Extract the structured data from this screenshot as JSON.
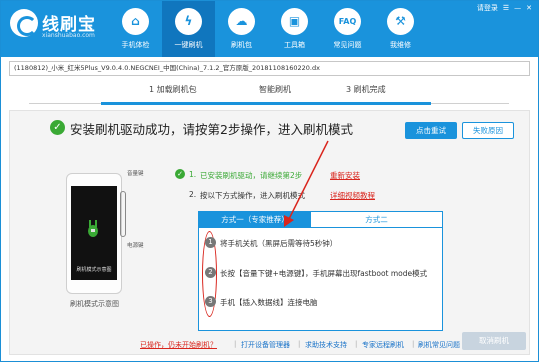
{
  "app": {
    "brand": "线刷宝",
    "brand_sub": "xianshuabao.com",
    "user_label": "请登录",
    "win_controls": [
      "☰",
      "—",
      "✕"
    ]
  },
  "nav": [
    {
      "label": "手机体检",
      "icon": "phone-check-icon",
      "glyph": "⌂",
      "active": false
    },
    {
      "label": "一键刷机",
      "icon": "flash-icon",
      "glyph": "ϟ",
      "active": true
    },
    {
      "label": "刷机包",
      "icon": "rom-package-icon",
      "glyph": "☁",
      "active": false
    },
    {
      "label": "工具箱",
      "icon": "toolbox-icon",
      "glyph": "▣",
      "active": false
    },
    {
      "label": "常见问题",
      "icon": "faq-icon",
      "glyph": "FAQ",
      "active": false
    },
    {
      "label": "我维修",
      "icon": "repair-icon",
      "glyph": "⚒",
      "active": false
    }
  ],
  "rom_path": "(1180812)_小米_红米5Plus_V9.0.4.0.NEGCNEI_中国(China)_7.1.2_官方原版_20181108160220.dx",
  "steps": {
    "step1": "1  加载刷机包",
    "step2": "智能刷机",
    "step3": "3  刷机完成"
  },
  "main": {
    "title": "安装刷机驱动成功，请按第2步操作，进入刷机模式",
    "btn_test": "点击重试",
    "btn_fail": "失败原因",
    "phone_screen_text": "刷机模式示意图",
    "phone_caption": "刷机模式示意图",
    "label_volume": "音量键",
    "label_power": "电源键",
    "inst1_num": "1.",
    "inst1_text": "已安装刷机驱动，请继续第2步",
    "inst1_link": "重新安装",
    "inst2_num": "2.",
    "inst2_text": "按以下方式操作，进入刷机模式",
    "inst2_link": "详细视频教程",
    "tab1": "方式一（专家推荐）",
    "tab2": "方式二",
    "ops": [
      {
        "num": "1",
        "text": "将手机关机（黑屏后需等待5秒钟）"
      },
      {
        "num": "2",
        "text": "长按【音量下键+电源键】，手机屏幕出现fastboot mode模式"
      },
      {
        "num": "3",
        "text": "手机【插入数据线】连接电脑"
      }
    ]
  },
  "footer": {
    "link_done": "已操作，仍未开始刷机？",
    "link_device_mgr": "打开设备管理器",
    "link_support": "求助技术支持",
    "link_remote": "专家远程刷机",
    "link_faq": "刷机常见问题",
    "btn_cancel": "取消刷机"
  },
  "colors": {
    "primary": "#1a93dc",
    "success": "#3aa935",
    "alert": "#d9251d"
  }
}
